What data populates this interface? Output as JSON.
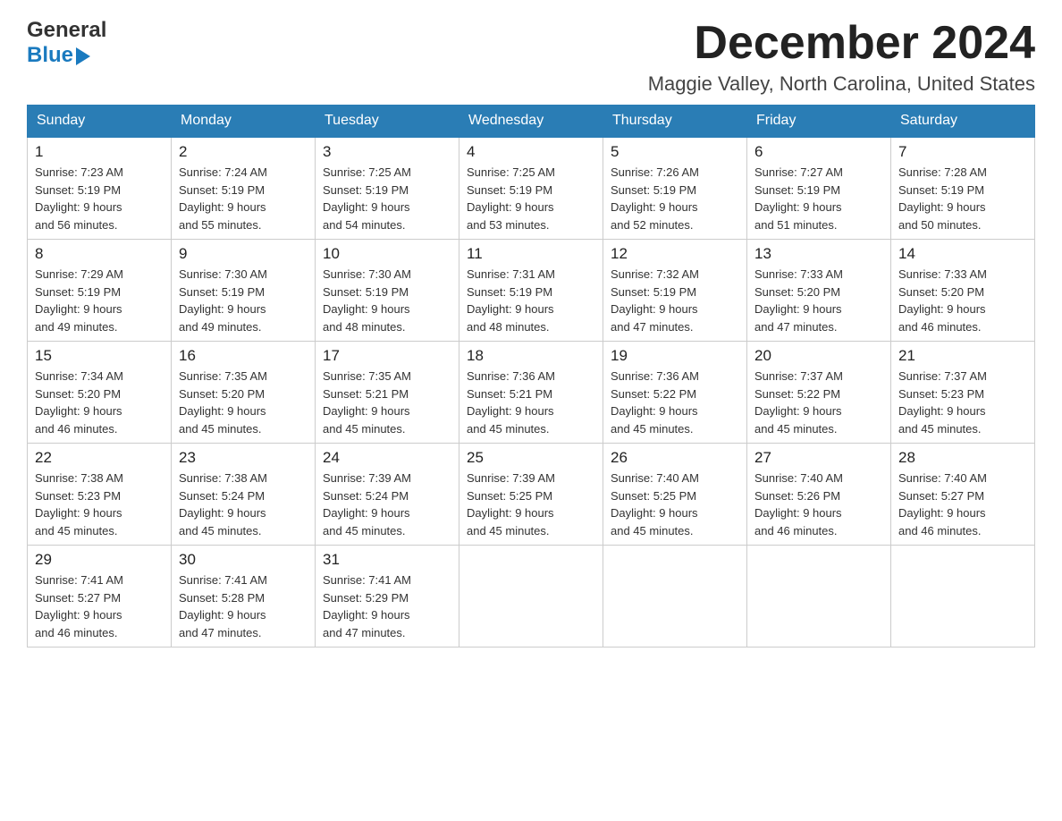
{
  "header": {
    "logo_general": "General",
    "logo_blue": "Blue",
    "month_title": "December 2024",
    "location": "Maggie Valley, North Carolina, United States"
  },
  "days_of_week": [
    "Sunday",
    "Monday",
    "Tuesday",
    "Wednesday",
    "Thursday",
    "Friday",
    "Saturday"
  ],
  "weeks": [
    [
      {
        "num": "1",
        "sunrise": "7:23 AM",
        "sunset": "5:19 PM",
        "daylight": "9 hours and 56 minutes."
      },
      {
        "num": "2",
        "sunrise": "7:24 AM",
        "sunset": "5:19 PM",
        "daylight": "9 hours and 55 minutes."
      },
      {
        "num": "3",
        "sunrise": "7:25 AM",
        "sunset": "5:19 PM",
        "daylight": "9 hours and 54 minutes."
      },
      {
        "num": "4",
        "sunrise": "7:25 AM",
        "sunset": "5:19 PM",
        "daylight": "9 hours and 53 minutes."
      },
      {
        "num": "5",
        "sunrise": "7:26 AM",
        "sunset": "5:19 PM",
        "daylight": "9 hours and 52 minutes."
      },
      {
        "num": "6",
        "sunrise": "7:27 AM",
        "sunset": "5:19 PM",
        "daylight": "9 hours and 51 minutes."
      },
      {
        "num": "7",
        "sunrise": "7:28 AM",
        "sunset": "5:19 PM",
        "daylight": "9 hours and 50 minutes."
      }
    ],
    [
      {
        "num": "8",
        "sunrise": "7:29 AM",
        "sunset": "5:19 PM",
        "daylight": "9 hours and 49 minutes."
      },
      {
        "num": "9",
        "sunrise": "7:30 AM",
        "sunset": "5:19 PM",
        "daylight": "9 hours and 49 minutes."
      },
      {
        "num": "10",
        "sunrise": "7:30 AM",
        "sunset": "5:19 PM",
        "daylight": "9 hours and 48 minutes."
      },
      {
        "num": "11",
        "sunrise": "7:31 AM",
        "sunset": "5:19 PM",
        "daylight": "9 hours and 48 minutes."
      },
      {
        "num": "12",
        "sunrise": "7:32 AM",
        "sunset": "5:19 PM",
        "daylight": "9 hours and 47 minutes."
      },
      {
        "num": "13",
        "sunrise": "7:33 AM",
        "sunset": "5:20 PM",
        "daylight": "9 hours and 47 minutes."
      },
      {
        "num": "14",
        "sunrise": "7:33 AM",
        "sunset": "5:20 PM",
        "daylight": "9 hours and 46 minutes."
      }
    ],
    [
      {
        "num": "15",
        "sunrise": "7:34 AM",
        "sunset": "5:20 PM",
        "daylight": "9 hours and 46 minutes."
      },
      {
        "num": "16",
        "sunrise": "7:35 AM",
        "sunset": "5:20 PM",
        "daylight": "9 hours and 45 minutes."
      },
      {
        "num": "17",
        "sunrise": "7:35 AM",
        "sunset": "5:21 PM",
        "daylight": "9 hours and 45 minutes."
      },
      {
        "num": "18",
        "sunrise": "7:36 AM",
        "sunset": "5:21 PM",
        "daylight": "9 hours and 45 minutes."
      },
      {
        "num": "19",
        "sunrise": "7:36 AM",
        "sunset": "5:22 PM",
        "daylight": "9 hours and 45 minutes."
      },
      {
        "num": "20",
        "sunrise": "7:37 AM",
        "sunset": "5:22 PM",
        "daylight": "9 hours and 45 minutes."
      },
      {
        "num": "21",
        "sunrise": "7:37 AM",
        "sunset": "5:23 PM",
        "daylight": "9 hours and 45 minutes."
      }
    ],
    [
      {
        "num": "22",
        "sunrise": "7:38 AM",
        "sunset": "5:23 PM",
        "daylight": "9 hours and 45 minutes."
      },
      {
        "num": "23",
        "sunrise": "7:38 AM",
        "sunset": "5:24 PM",
        "daylight": "9 hours and 45 minutes."
      },
      {
        "num": "24",
        "sunrise": "7:39 AM",
        "sunset": "5:24 PM",
        "daylight": "9 hours and 45 minutes."
      },
      {
        "num": "25",
        "sunrise": "7:39 AM",
        "sunset": "5:25 PM",
        "daylight": "9 hours and 45 minutes."
      },
      {
        "num": "26",
        "sunrise": "7:40 AM",
        "sunset": "5:25 PM",
        "daylight": "9 hours and 45 minutes."
      },
      {
        "num": "27",
        "sunrise": "7:40 AM",
        "sunset": "5:26 PM",
        "daylight": "9 hours and 46 minutes."
      },
      {
        "num": "28",
        "sunrise": "7:40 AM",
        "sunset": "5:27 PM",
        "daylight": "9 hours and 46 minutes."
      }
    ],
    [
      {
        "num": "29",
        "sunrise": "7:41 AM",
        "sunset": "5:27 PM",
        "daylight": "9 hours and 46 minutes."
      },
      {
        "num": "30",
        "sunrise": "7:41 AM",
        "sunset": "5:28 PM",
        "daylight": "9 hours and 47 minutes."
      },
      {
        "num": "31",
        "sunrise": "7:41 AM",
        "sunset": "5:29 PM",
        "daylight": "9 hours and 47 minutes."
      },
      null,
      null,
      null,
      null
    ]
  ],
  "labels": {
    "sunrise": "Sunrise:",
    "sunset": "Sunset:",
    "daylight": "Daylight:"
  }
}
